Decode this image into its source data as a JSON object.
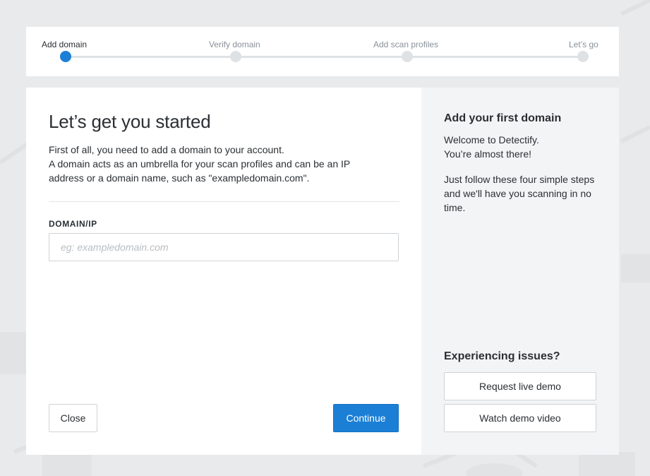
{
  "stepper": {
    "steps": [
      {
        "label": "Add domain",
        "active": true
      },
      {
        "label": "Verify domain",
        "active": false
      },
      {
        "label": "Add scan profiles",
        "active": false
      },
      {
        "label": "Let’s go",
        "active": false
      }
    ]
  },
  "main": {
    "title": "Let’s get you started",
    "intro_line1": "First of all, you need to add a domain to your account.",
    "intro_line2": "A domain acts as an umbrella for your scan profiles and can be an IP address or a domain name, such as \"exampledomain.com\".",
    "field_label": "DOMAIN/IP",
    "domain_input": {
      "value": "",
      "placeholder": "eg: exampledomain.com"
    },
    "close_label": "Close",
    "continue_label": "Continue"
  },
  "side": {
    "title": "Add your first domain",
    "welcome_line1": "Welcome to Detectify.",
    "welcome_line2": "You’re almost there!",
    "follow_text": "Just follow these four simple steps and we'll have you scanning in no time.",
    "issues_title": "Experiencing issues?",
    "demo_button_label": "Request live demo",
    "video_button_label": "Watch demo video"
  },
  "colors": {
    "accent": "#1b7fd6",
    "background": "#e9eaeb",
    "side_panel": "#f3f4f5",
    "inactive_step": "#dfe2e5"
  }
}
